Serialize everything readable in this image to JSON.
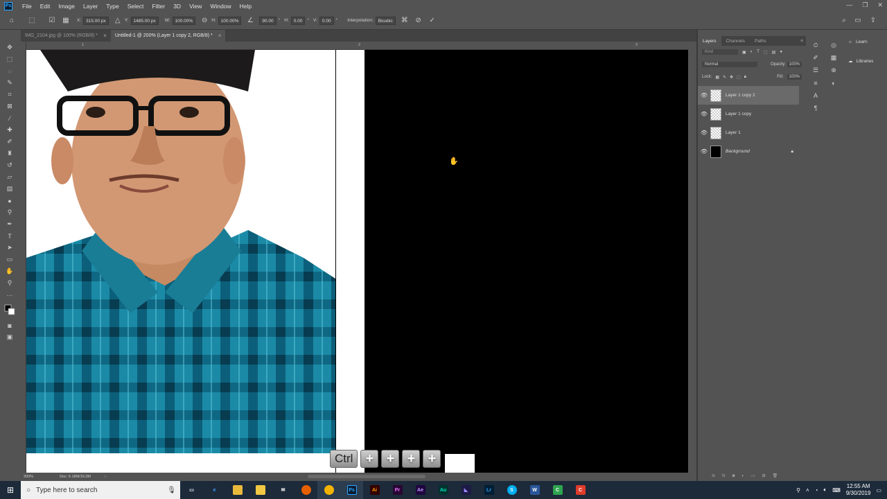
{
  "app": {
    "logo": "Ps"
  },
  "menu": [
    "File",
    "Edit",
    "Image",
    "Layer",
    "Type",
    "Select",
    "Filter",
    "3D",
    "View",
    "Window",
    "Help"
  ],
  "options": {
    "x_label": "X:",
    "x_value": "315.00 px",
    "y_label": "Y:",
    "y_value": "1485.00 px",
    "w_label": "W:",
    "w_value": "100.00%",
    "h_label": "H:",
    "h_value": "100.00%",
    "angle_value": "90.00",
    "hskew_label": "H:",
    "hskew_value": "0.00",
    "vskew_label": "V:",
    "vskew_value": "0.00",
    "interp_label": "Interpolation:",
    "interp_value": "Bicubic"
  },
  "tabs": [
    {
      "label": "IMG_2104.jpg @ 100% (RGB/8) *",
      "active": false
    },
    {
      "label": "Untitled-1 @ 200% (Layer 1 copy 2, RGB/8) *",
      "active": true
    }
  ],
  "ruler": {
    "ticks": [
      "1",
      "2",
      "3"
    ]
  },
  "status": {
    "zoom": "200%",
    "doc": "Doc: 6.18M/16.0M"
  },
  "keys": [
    "Ctrl",
    "+",
    "+",
    "+",
    "+"
  ],
  "layers_panel": {
    "tabs": [
      "Layers",
      "Channels",
      "Paths"
    ],
    "kind_placeholder": "Kind",
    "blend_mode": "Normal",
    "opacity_label": "Opacity:",
    "opacity_value": "100%",
    "lock_label": "Lock:",
    "fill_label": "Fill:",
    "fill_value": "100%",
    "layers": [
      {
        "name": "Layer 1 copy 2",
        "selected": true
      },
      {
        "name": "Layer 1 copy",
        "selected": false
      },
      {
        "name": "Layer 1",
        "selected": false
      },
      {
        "name": "Background",
        "selected": false
      }
    ]
  },
  "learn_panel": {
    "learn": "Learn",
    "libraries": "Libraries"
  },
  "taskbar": {
    "search_placeholder": "Type here to search",
    "time": "12:55 AM",
    "date": "9/30/2019"
  },
  "colors": {
    "accent": "#31a8ff",
    "canvas_bg": "#535353",
    "taskbar": "#1c2a3a"
  }
}
